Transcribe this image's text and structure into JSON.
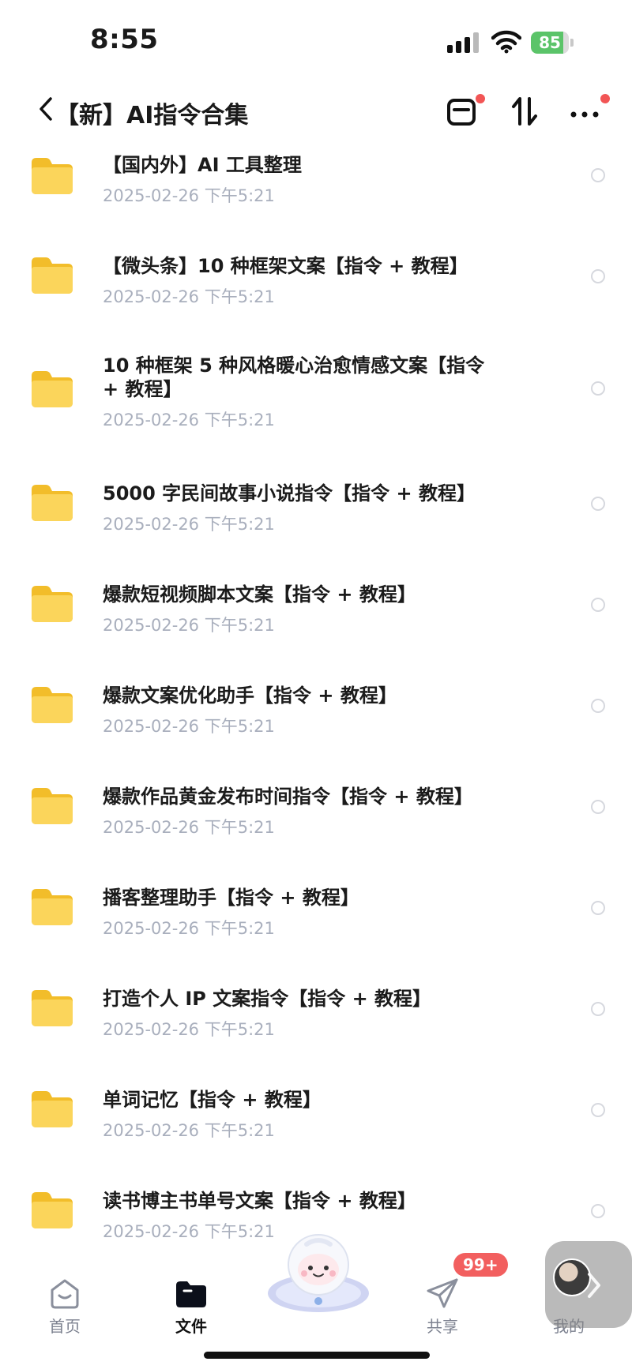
{
  "status_bar": {
    "time": "8:55",
    "battery": "85",
    "battery_level": 0.85
  },
  "nav": {
    "title": "【新】AI指令合集"
  },
  "files": [
    {
      "name": "【国内外】AI 工具整理",
      "date": "2025-02-26 下午5:21"
    },
    {
      "name": "【微头条】10 种框架文案【指令 + 教程】",
      "date": "2025-02-26 下午5:21"
    },
    {
      "name": "10 种框架 5 种风格暖心治愈情感文案【指令 + 教程】",
      "date": "2025-02-26 下午5:21"
    },
    {
      "name": "5000 字民间故事小说指令【指令 + 教程】",
      "date": "2025-02-26 下午5:21"
    },
    {
      "name": "爆款短视频脚本文案【指令 + 教程】",
      "date": "2025-02-26 下午5:21"
    },
    {
      "name": "爆款文案优化助手【指令 + 教程】",
      "date": "2025-02-26 下午5:21"
    },
    {
      "name": "爆款作品黄金发布时间指令【指令 + 教程】",
      "date": "2025-02-26 下午5:21"
    },
    {
      "name": "播客整理助手【指令 + 教程】",
      "date": "2025-02-26 下午5:21"
    },
    {
      "name": "打造个人 IP 文案指令【指令 + 教程】",
      "date": "2025-02-26 下午5:21"
    },
    {
      "name": "单词记忆【指令 + 教程】",
      "date": "2025-02-26 下午5:21"
    },
    {
      "name": "读书博主书单号文案【指令 + 教程】",
      "date": "2025-02-26 下午5:21"
    }
  ],
  "tabs": {
    "home": "首页",
    "files": "文件",
    "share": "共享",
    "mine": "我的",
    "share_badge": "99+"
  },
  "colors": {
    "folder": "#f9cf45",
    "badge": "#f25f5f",
    "date_text": "#a9afbd",
    "battery": "#5bc469"
  },
  "icons": [
    "back-icon",
    "inbox-icon",
    "sort-icon",
    "more-icon",
    "folder-icon",
    "home-icon",
    "files-icon",
    "share-icon",
    "mascot-icon"
  ]
}
